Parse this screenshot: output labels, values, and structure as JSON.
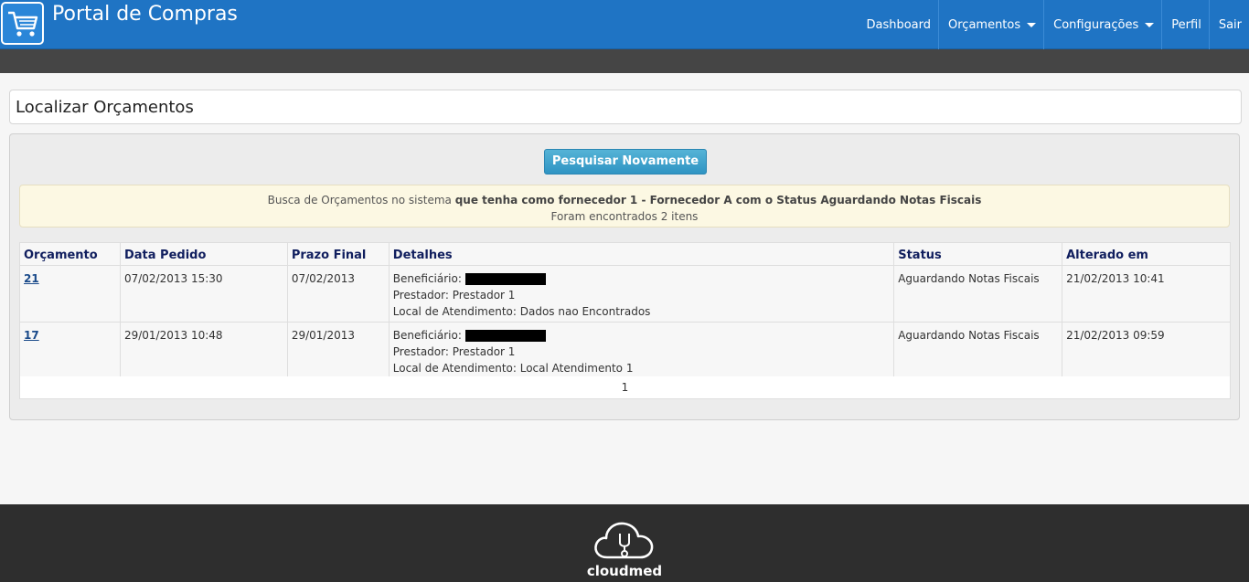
{
  "header": {
    "title": "Portal de Compras",
    "logo_icon": "shopping-cart-icon",
    "nav": {
      "dashboard": "Dashboard",
      "orcamentos": "Orçamentos",
      "configuracoes": "Configurações",
      "perfil": "Perfil",
      "sair": "Sair"
    }
  },
  "page": {
    "title": "Localizar Orçamentos"
  },
  "search": {
    "button": "Pesquisar Novamente",
    "summary_prefix": "Busca de Orçamentos no sistema",
    "summary_bold": "que tenha como fornecedor 1 - Fornecedor A com o Status Aguardando Notas Fiscais",
    "summary_count": "Foram encontrados 2 itens"
  },
  "table": {
    "columns": {
      "orcamento": "Orçamento",
      "data_pedido": "Data Pedido",
      "prazo_final": "Prazo Final",
      "detalhes": "Detalhes",
      "status": "Status",
      "alterado_em": "Alterado em"
    },
    "rows": [
      {
        "orcamento": "21",
        "data_pedido": "07/02/2013 15:30",
        "prazo_final": "07/02/2013",
        "beneficiario_label": "Beneficiário:",
        "prestador": "Prestador: Prestador 1",
        "local": "Local de Atendimento: Dados nao Encontrados",
        "status": "Aguardando Notas Fiscais",
        "alterado_em": "21/02/2013 10:41"
      },
      {
        "orcamento": "17",
        "data_pedido": "29/01/2013 10:48",
        "prazo_final": "29/01/2013",
        "beneficiario_label": "Beneficiário:",
        "prestador": "Prestador: Prestador 1",
        "local": "Local de Atendimento: Local Atendimento 1",
        "status": "Aguardando Notas Fiscais",
        "alterado_em": "21/02/2013 09:59"
      }
    ],
    "pagination": "1"
  },
  "footer": {
    "brand": "cloudmed",
    "logo_icon": "cloud-stethoscope-icon"
  },
  "colors": {
    "header_bg": "#1f74c4",
    "subbar_bg": "#454545",
    "button_bg": "#3ba3cf",
    "alert_bg": "#fcf8e3",
    "footer_bg": "#2e2e2e"
  }
}
